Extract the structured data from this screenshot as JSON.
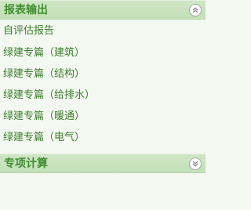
{
  "panels": [
    {
      "title": "报表输出",
      "toggle_icon": "collapse-up-icon",
      "items": [
        {
          "label": "自评估报告"
        },
        {
          "label": "绿建专篇（建筑）"
        },
        {
          "label": "绿建专篇（结构）"
        },
        {
          "label": "绿建专篇（给排水）"
        },
        {
          "label": "绿建专篇（暖通）"
        },
        {
          "label": "绿建专篇（电气）"
        }
      ]
    },
    {
      "title": "专项计算",
      "toggle_icon": "expand-down-icon"
    }
  ],
  "colors": {
    "header_background": "#c6e2bb",
    "title_text": "#3f8f2e",
    "item_text": "#3a7f2c",
    "panel_background": "#f3f8f0"
  }
}
